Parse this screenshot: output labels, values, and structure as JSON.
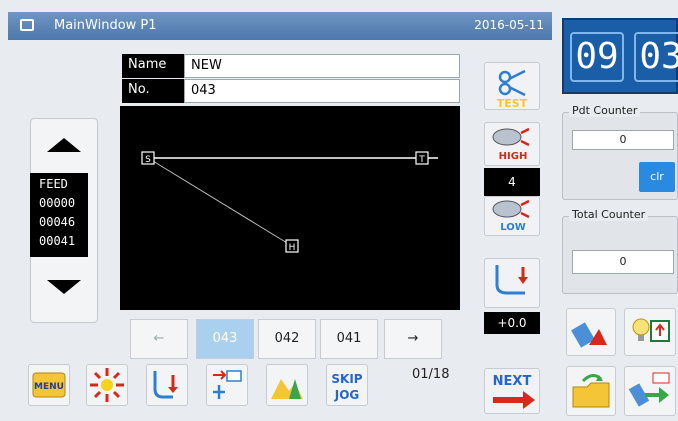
{
  "window": {
    "title": "MainWindow P1",
    "date": "2016-05-11"
  },
  "pattern": {
    "name_label": "Name",
    "name_value": "NEW",
    "no_label": "No.",
    "no_value": "043"
  },
  "feed": {
    "label": "FEED",
    "values": [
      "00000",
      "00046",
      "00041"
    ]
  },
  "canvas_points": {
    "start": "S",
    "end": "T",
    "mid": "H"
  },
  "pager": {
    "prev": "←",
    "items": [
      "043",
      "042",
      "041"
    ],
    "next": "→",
    "page_count": "01/18"
  },
  "toolbar": {
    "menu": "MENU",
    "skip": "SKIP",
    "jog": "JOG",
    "next": "NEXT"
  },
  "right": {
    "test_label": "TEST",
    "high_label": "HIGH",
    "speed_value": "4",
    "low_label": "LOW",
    "offset_value": "+0.0"
  },
  "clock": {
    "hour": "09",
    "minute": "03"
  },
  "counters": {
    "pdt_label": "Pdt Counter",
    "pdt_value": "0",
    "clr_label": "clr",
    "total_label": "Total Counter",
    "total_value": "0"
  },
  "colors": {
    "titlebar": "#5b84b6",
    "accent_blue": "#2a8ae2",
    "clock_bg": "#1a5ea8",
    "canvas": "#000000"
  }
}
